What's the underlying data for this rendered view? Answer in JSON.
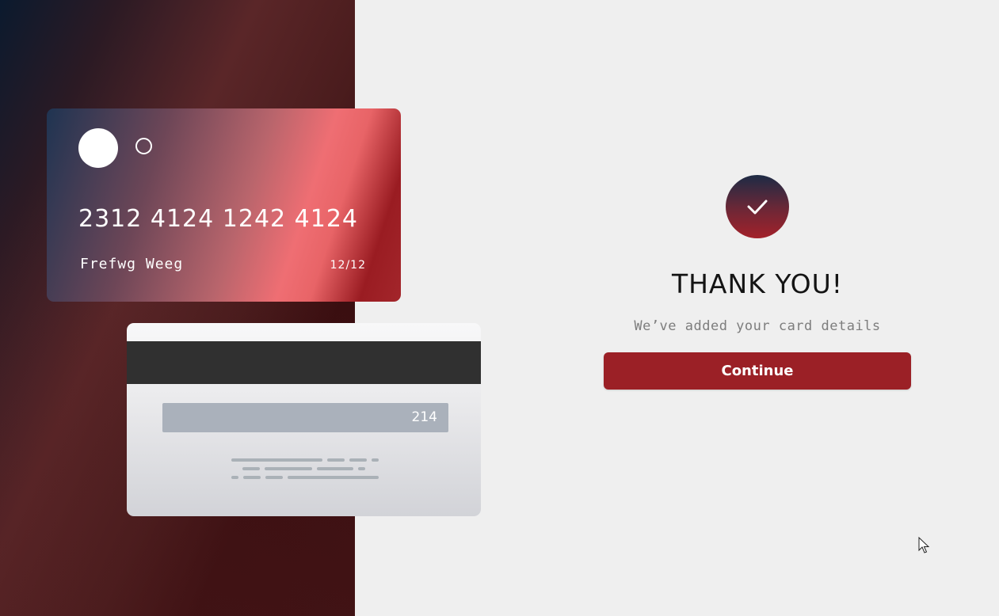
{
  "card_front": {
    "number": "2312 4124 1242 4124",
    "holder": "Frefwg Weeg",
    "expiry": "12/12"
  },
  "card_back": {
    "cvv": "214"
  },
  "confirmation": {
    "icon": "check-icon",
    "title": "THANK YOU!",
    "subtitle": "We’ve added your card details",
    "button_label": "Continue"
  },
  "colors": {
    "accent": "#9b2026",
    "background": "#efefef",
    "left_panel": "#4a1c1d"
  }
}
